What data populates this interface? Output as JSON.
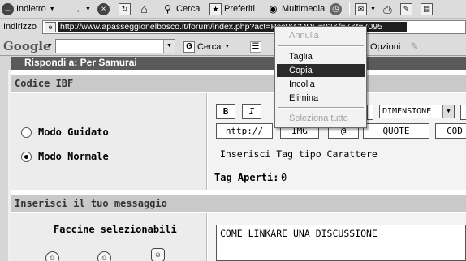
{
  "toolbar": {
    "back_label": "Indietro",
    "search_label": "Cerca",
    "favorites_label": "Preferiti",
    "multimedia_label": "Multimedia"
  },
  "address_bar": {
    "label": "Indirizzo",
    "url": "http://www.apasseggionelbosco.it/forum/index.php?act=Post&CODE=02&f=7&t=7095"
  },
  "google_bar": {
    "logo": "Google",
    "search_value": "",
    "search_button_label": "Cerca",
    "options_label": "Opzioni"
  },
  "page": {
    "title": "Rispondi a: Per Samurai",
    "section_ibf": "Codice IBF",
    "mode_guided": "Modo Guidato",
    "mode_normal": "Modo Normale",
    "mode_selected": "normal",
    "bold_btn": "B",
    "italic_btn": "I",
    "size_select": "DIMENSIONE",
    "tag_buttons": [
      "http://",
      "IMG",
      "@",
      "QUOTE",
      "COD"
    ],
    "insert_tag_text": "Inserisci Tag tipo Carattere",
    "open_tags_label": "Tag Aperti:",
    "open_tags_value": "0",
    "section_message": "Inserisci il tuo messaggio",
    "smileys_label": "Faccine selezionabili",
    "message_text": "COME LINKARE UNA DISCUSSIONE"
  },
  "context_menu": {
    "items": [
      {
        "label": "Annulla",
        "enabled": false
      },
      {
        "label": "Taglia",
        "enabled": true
      },
      {
        "label": "Copia",
        "enabled": true,
        "highlighted": true
      },
      {
        "label": "Incolla",
        "enabled": true
      },
      {
        "label": "Elimina",
        "enabled": true
      },
      {
        "label": "Seleziona tutto",
        "enabled": false
      }
    ]
  },
  "icons": [
    "back-arrow-icon",
    "forward-arrow-icon",
    "stop-icon",
    "refresh-icon",
    "home-icon",
    "search-icon",
    "favorites-icon",
    "multimedia-icon",
    "history-icon",
    "mail-icon",
    "print-icon",
    "edit-icon",
    "page-icon",
    "google-search-icon",
    "highlighter-icon"
  ]
}
